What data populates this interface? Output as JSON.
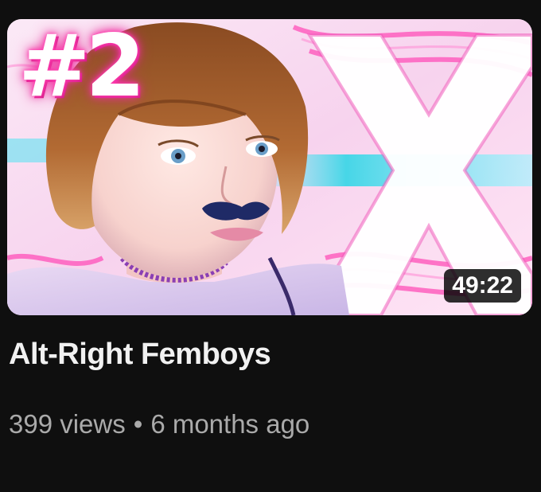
{
  "video": {
    "title": "Alt-Right Femboys",
    "duration": "49:22",
    "rank_badge": "#2",
    "views": "399 views",
    "separator": "•",
    "age": "6 months ago"
  },
  "colors": {
    "background": "#0f0f0f",
    "title_text": "#f1f1f1",
    "meta_text": "#aaaaaa",
    "accent_pink": "#ff3fb0",
    "accent_cyan": "#33d6e6"
  },
  "icons": {
    "thumbnail_symbol": "x-logo-icon"
  }
}
